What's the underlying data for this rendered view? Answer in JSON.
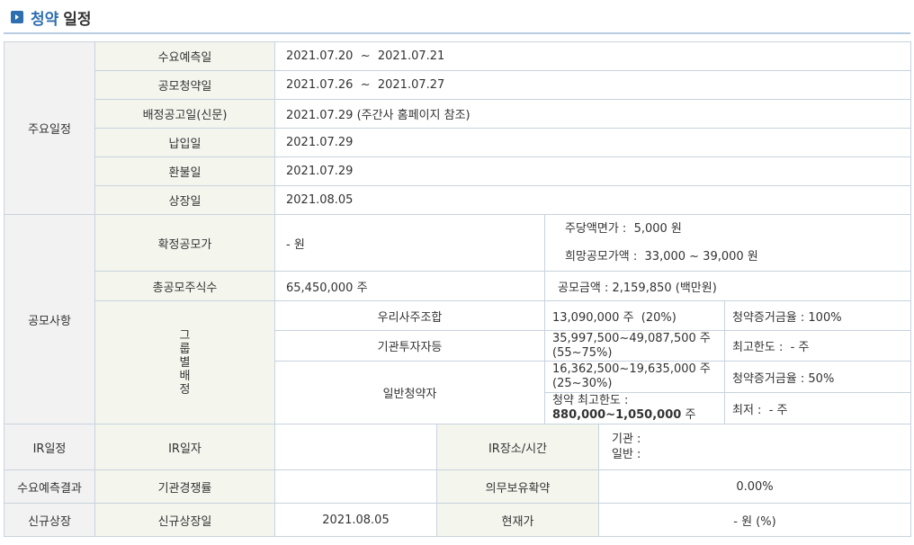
{
  "header": {
    "title_accent": "청약",
    "title_rest": "일정"
  },
  "main_schedule": {
    "section": "주요일정",
    "rows": [
      {
        "label": "수요예측일",
        "value": "2021.07.20  ~  2021.07.21"
      },
      {
        "label": "공모청약일",
        "value": "2021.07.26  ~  2021.07.27"
      },
      {
        "label": "배정공고일(신문)",
        "value": "2021.07.29 (주간사 홈페이지 참조)"
      },
      {
        "label": "납입일",
        "value": "2021.07.29"
      },
      {
        "label": "환불일",
        "value": "2021.07.29"
      },
      {
        "label": "상장일",
        "value": "2021.08.05"
      }
    ]
  },
  "offering": {
    "section": "공모사항",
    "final_price_label": "확정공모가",
    "final_price_value": "- 원",
    "par_value": "주당액면가 :  5,000 원",
    "desired_price": "희망공모가액 :  33,000 ~ 39,000 원",
    "total_shares_label": "총공모주식수",
    "total_shares_value": "65,450,000 주",
    "total_amount": "공모금액 : 2,159,850 (백만원)",
    "group_label_chars": [
      "그",
      "룹",
      "별",
      "배",
      "정"
    ],
    "groups": {
      "employee": {
        "name": "우리사주조합",
        "shares": "13,090,000 주  (20%)",
        "note": "청약증거금율 : 100%"
      },
      "institution": {
        "name": "기관투자자등",
        "shares_line1": "35,997,500~49,087,500 주",
        "shares_line2": "(55~75%)",
        "note": "최고한도 :  - 주"
      },
      "retail": {
        "name": "일반청약자",
        "shares_line1": "16,362,500~19,635,000 주",
        "shares_line2": "(25~30%)",
        "note": "청약증거금율 : 50%",
        "limit_label": "청약 최고한도 :",
        "limit_value": "880,000~1,050,000",
        "limit_unit": "주",
        "minimum": "최저 :  - 주"
      }
    }
  },
  "ir": {
    "section": "IR일정",
    "date_label": "IR일자",
    "date_value": "",
    "place_label": "IR장소/시간",
    "institution_line": "기관 :",
    "retail_line": "일반 :"
  },
  "demand_result": {
    "section": "수요예측결과",
    "competition_label": "기관경쟁률",
    "competition_value": "",
    "lockup_label": "의무보유확약",
    "lockup_value": "0.00%"
  },
  "listing": {
    "section": "신규상장",
    "date_label": "신규상장일",
    "date_value": "2021.08.05",
    "price_label": "현재가",
    "price_value": "- 원 (%)"
  }
}
